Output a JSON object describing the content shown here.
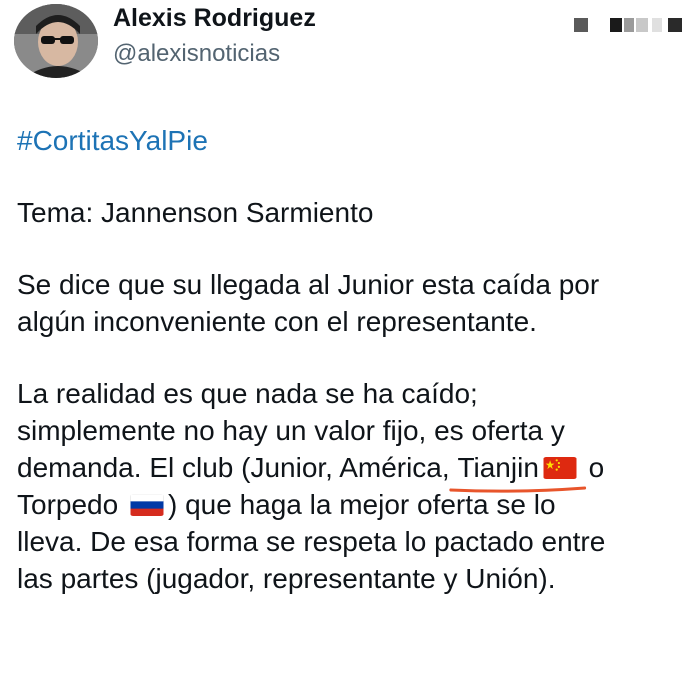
{
  "author": {
    "display_name": "Alexis Rodriguez",
    "handle": "@alexisnoticias",
    "avatar_icon": "profile-photo"
  },
  "more_menu_icon": "more-options-icon",
  "post": {
    "hashtag": "#CortitasYalPie",
    "topic": "Tema: Jannenson Sarmiento",
    "para1_line1": "Se dice que su llegada al Junior esta caída por",
    "para1_line2": "algún inconveniente con el representante.",
    "para2_line1": "La realidad es que nada se ha caído;",
    "para2_line2": "simplemente no hay un valor fijo, es oferta y",
    "para2_line3_a": "demanda. El club (Junior, América, ",
    "para2_line3_tianjin": "Tianjin",
    "para2_line3_b": " o",
    "para2_line4_a": "Torpedo ",
    "para2_line4_b": ") que haga la mejor oferta se lo",
    "para2_line5": "lleva. De esa forma se respeta lo pactado entre",
    "para2_line6": "las partes (jugador, representante y Unión)."
  },
  "flags": {
    "china": "china-flag-icon",
    "russia": "russia-flag-icon"
  },
  "colors": {
    "hashtag": "#1d73b5",
    "handle": "#536471",
    "annotation_underline": "#e8552b"
  }
}
